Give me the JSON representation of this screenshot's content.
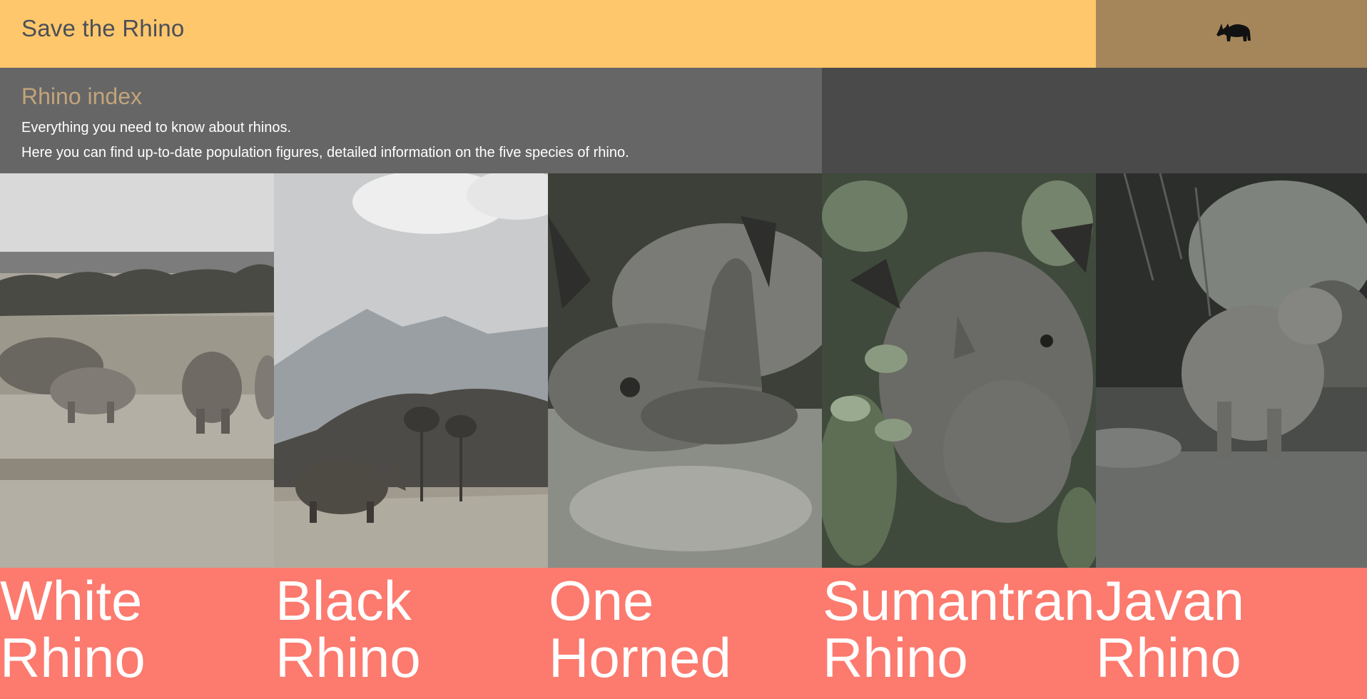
{
  "header": {
    "title": "Save the Rhino",
    "logo_icon": "rhino-silhouette-icon"
  },
  "intro": {
    "heading": "Rhino index",
    "line1": "Everything you need to know about rhinos.",
    "line2": "Here you can find up-to-date population figures, detailed information on the five species of rhino."
  },
  "species": [
    {
      "line1": "White",
      "line2": "Rhino"
    },
    {
      "line1": "Black",
      "line2": "Rhino"
    },
    {
      "line1": "One",
      "line2": "Horned"
    },
    {
      "line1": "Sumantran",
      "line2": "Rhino"
    },
    {
      "line1": "Javan",
      "line2": "Rhino"
    }
  ],
  "colors": {
    "header": "#fec76b",
    "logo_box": "#a5865a",
    "intro": "#666666",
    "heading": "#c2a47a",
    "labels_bg": "#fc7a6e"
  }
}
